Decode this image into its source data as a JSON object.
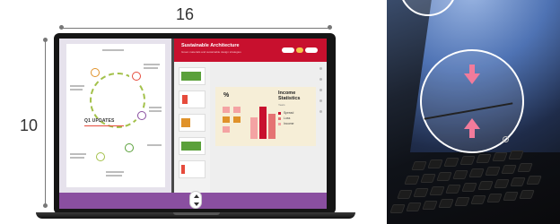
{
  "dimensions": {
    "width_label": "16",
    "height_label": "10"
  },
  "app": {
    "title": "Sustainable Architecture",
    "subtitle": "Green materials and sustainable design strategies",
    "slide": {
      "percent": "%",
      "title": "Income Statistics",
      "sub": "Years",
      "legend": [
        {
          "label": "Spread",
          "color": "#c8102e"
        },
        {
          "label": "Loss",
          "color": "#e57373"
        },
        {
          "label": "Income",
          "color": "#f4a3a3"
        }
      ]
    }
  },
  "infographic": {
    "title": "Q1 UPDATES"
  },
  "colors": {
    "header": "#c8102e",
    "bottom_bar": "#8a4fa0",
    "arrows": "#f27b9b"
  },
  "icons": [
    "split-handle-icon",
    "arrow-down-icon",
    "arrow-up-icon",
    "power-icon"
  ]
}
